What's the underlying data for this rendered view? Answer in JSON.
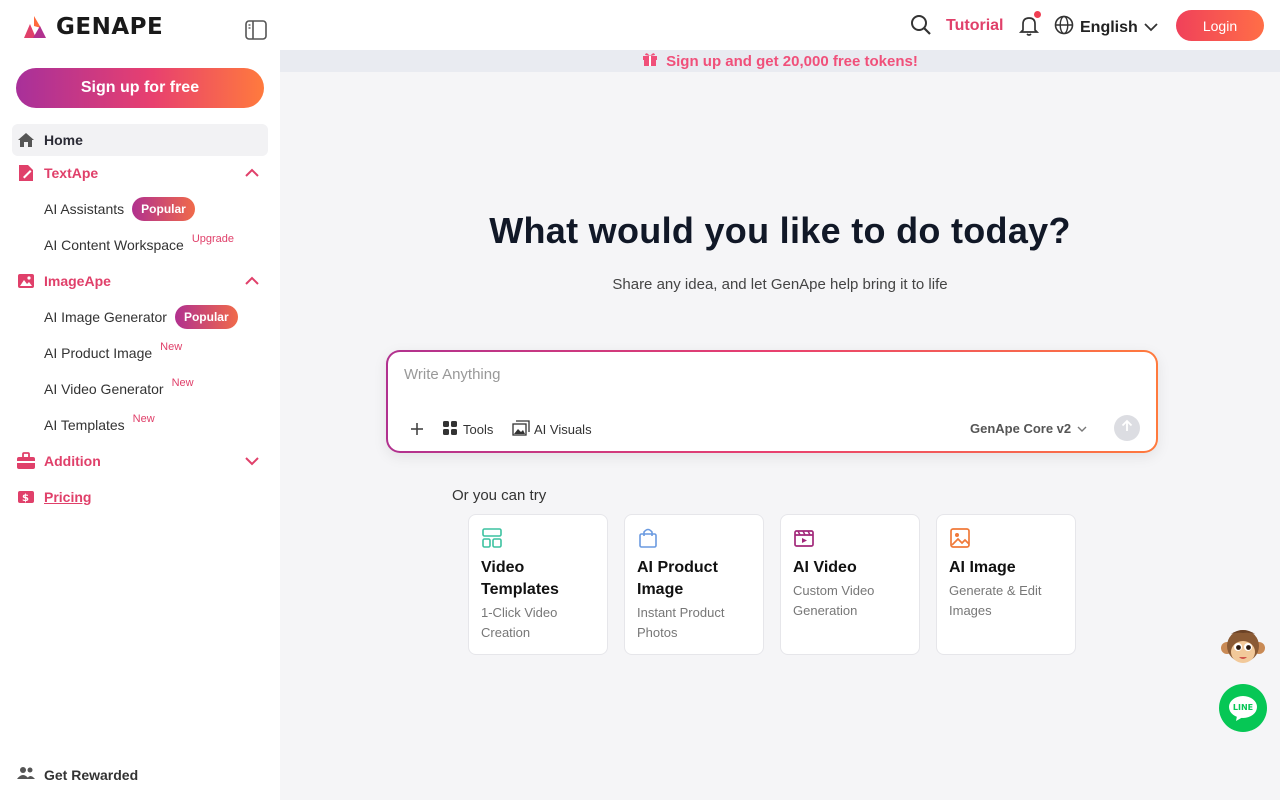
{
  "brand": {
    "name": "GENAPE"
  },
  "sidebar": {
    "signup_label": "Sign up for free",
    "home_label": "Home",
    "textape": {
      "label": "TextApe",
      "items": [
        {
          "label": "AI Assistants",
          "badge": "Popular"
        },
        {
          "label": "AI Content Workspace",
          "tag": "Upgrade"
        }
      ]
    },
    "imageape": {
      "label": "ImageApe",
      "items": [
        {
          "label": "AI Image Generator",
          "badge": "Popular"
        },
        {
          "label": "AI Product Image",
          "tag": "New"
        },
        {
          "label": "AI Video Generator",
          "tag": "New"
        },
        {
          "label": "AI Templates",
          "tag": "New"
        }
      ]
    },
    "addition_label": "Addition",
    "pricing_label": "Pricing",
    "get_rewarded_label": "Get Rewarded"
  },
  "topbar": {
    "tutorial_label": "Tutorial",
    "language_label": "English",
    "login_label": "Login"
  },
  "promo": {
    "text": "Sign up and get 20,000 free tokens!"
  },
  "hero": {
    "title": "What would you like to do today?",
    "subtitle": "Share any idea, and let GenApe help bring it to life"
  },
  "composer": {
    "placeholder": "Write Anything",
    "tools_label": "Tools",
    "visuals_label": "AI Visuals",
    "model_label": "GenApe Core v2"
  },
  "suggestions": {
    "heading": "Or you can try",
    "cards": [
      {
        "title": "Video Templates",
        "desc": "1-Click Video Creation",
        "icon": "layout-icon"
      },
      {
        "title": "AI Product Image",
        "desc": "Instant Product Photos",
        "icon": "shopping-bag-icon"
      },
      {
        "title": "AI Video",
        "desc": "Custom Video Generation",
        "icon": "video-clapper-icon"
      },
      {
        "title": "AI Image",
        "desc": "Generate & Edit Images",
        "icon": "image-icon"
      }
    ]
  },
  "colors": {
    "accent": "#e0406a",
    "gradient_start": "#a8309a",
    "gradient_end": "#ff7a3d",
    "line_green": "#06c755"
  }
}
